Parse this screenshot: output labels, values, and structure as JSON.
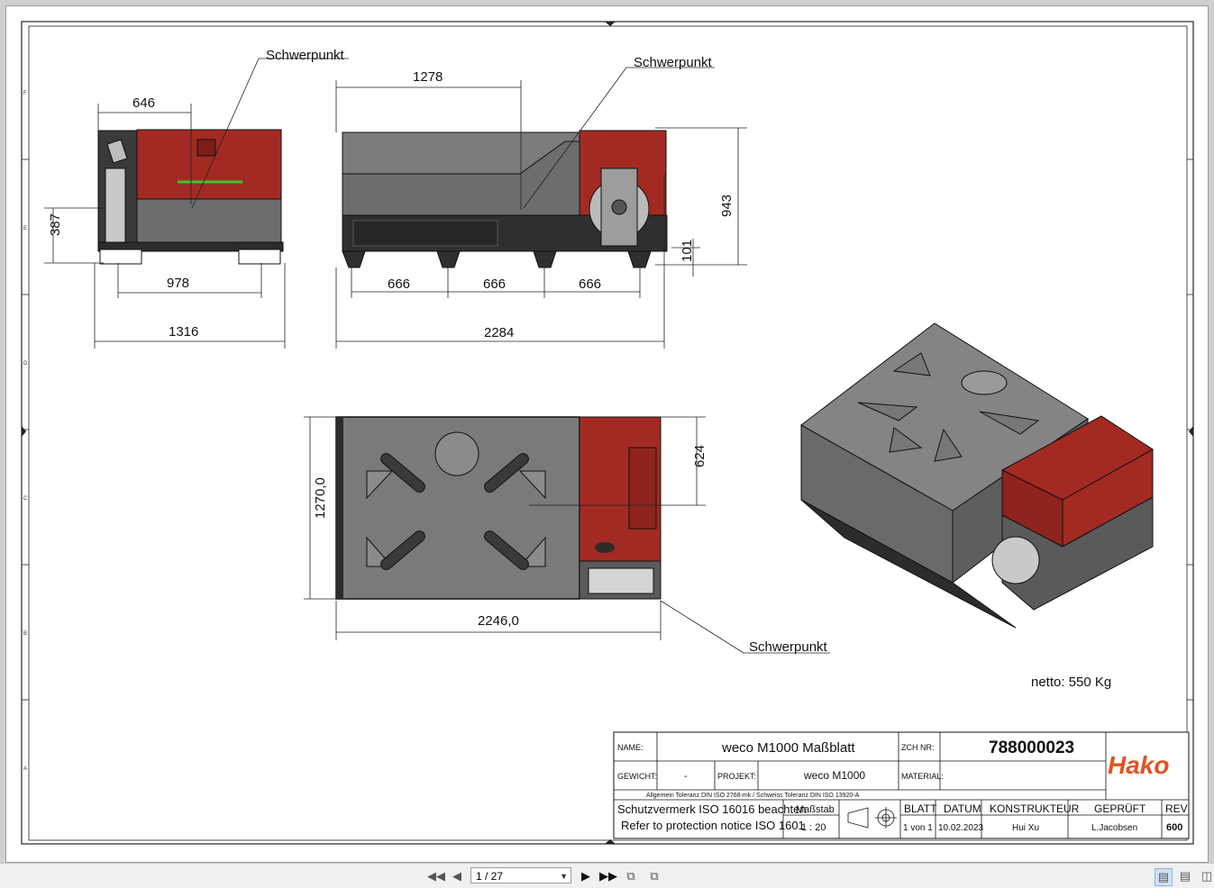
{
  "drawing": {
    "callouts": {
      "cog_label": "Schwerpunkt"
    },
    "dims": {
      "side_width_top": "646",
      "side_height_left": "387",
      "side_inner_width": "978",
      "side_total_width": "1316",
      "front_offset": "1278",
      "front_height": "943",
      "front_ground": "101",
      "front_seg1": "666",
      "front_seg2": "666",
      "front_seg3": "666",
      "front_total": "2284",
      "top_height": "1270,0",
      "top_width": "2246,0",
      "top_cog_offset": "624"
    },
    "weight_note": "netto: 550 Kg",
    "colors": {
      "body_grey": "#6d6d6d",
      "lid_grey": "#8a8a8a",
      "red": "#a32a22",
      "dark": "#2c2c2c",
      "green": "#32c832",
      "hako_orange": "#e0541e"
    }
  },
  "title_block": {
    "name_label": "NAME:",
    "name_value": "weco M1000 Maßblatt",
    "zch_label": "ZCH NR:",
    "zch_value": "788000023",
    "gewicht_label": "GEWICHT:",
    "gewicht_value": "-",
    "projekt_label": "PROJEKT:",
    "projekt_value": "weco M1000",
    "material_label": "MATERIAL:",
    "material_value": "",
    "tolerance_note": "Allgemein Toleranz DIN ISO 2768-mk / Schweiss Toleranz DIN ISO 13920-A",
    "protection_de": "Schutzvermerk  ISO 16016 beachten",
    "protection_en": "Refer to protection notice ISO 1601",
    "massstab_label": "Maßstab",
    "massstab_value": "1 : 20",
    "blatt_label": "BLATT",
    "blatt_value": "1 von 1",
    "datum_label": "DATUM",
    "datum_value": "10.02.2023",
    "konstrukteur_label": "KONSTRUKTEUR",
    "konstrukteur_value": "Hui Xu",
    "geprueft_label": "GEPRÜFT",
    "geprueft_value": "L.Jacobsen",
    "rev_label": "REV",
    "rev_value": "600",
    "logo_text": "Hako"
  },
  "border_letters": {
    "left": [
      "F",
      "E",
      "D",
      "C",
      "B",
      "A"
    ]
  },
  "toolbar": {
    "page_indicator": "1 / 27",
    "first_icon": "first-page-icon",
    "prev_icon": "previous-page-icon",
    "next_icon": "next-page-icon",
    "last_icon": "last-page-icon"
  }
}
